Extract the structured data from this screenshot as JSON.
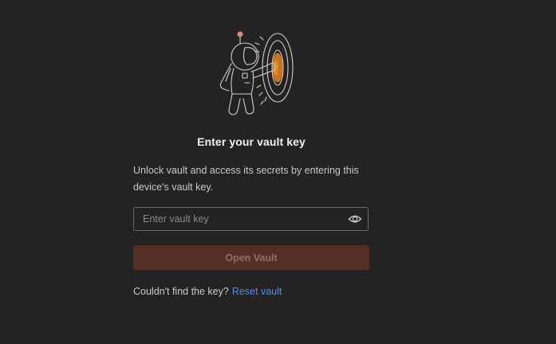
{
  "illustration": {
    "icon": "astronaut-opening-vault-door",
    "accent_color": "#c8741a"
  },
  "title": "Enter your vault key",
  "description": "Unlock vault and access its secrets by entering this device's vault key.",
  "key_input": {
    "placeholder": "Enter vault key",
    "value": ""
  },
  "visibility_toggle": {
    "icon": "eye-icon"
  },
  "open_button": {
    "label": "Open Vault",
    "enabled": false,
    "color": "#552f25"
  },
  "footer": {
    "prompt": "Couldn't find the key?",
    "link_label": "Reset vault",
    "link_color": "#4b8ef0"
  },
  "colors": {
    "background": "#232323",
    "text_primary": "#f2f2f2",
    "text_secondary": "#c9c9c9"
  }
}
